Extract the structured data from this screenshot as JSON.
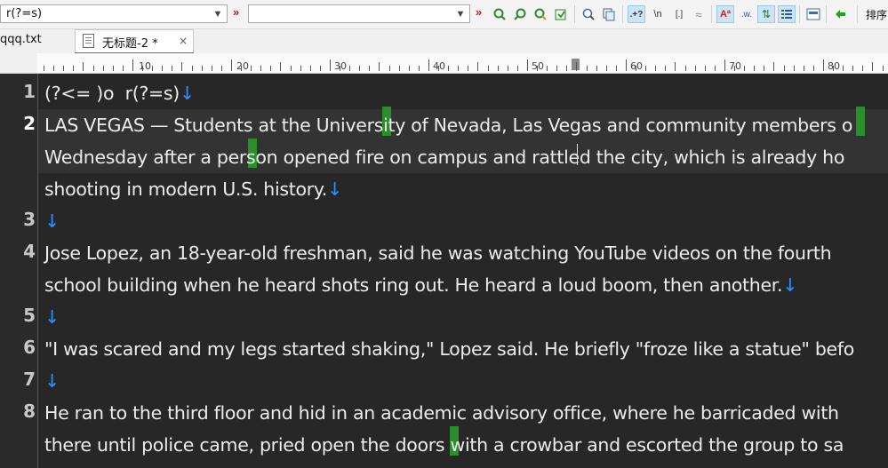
{
  "toolbar": {
    "find_combo_value": "r(?=s)",
    "replace_combo_value": "",
    "arrow_glyph": "»",
    "right_text": "排序",
    "icons": [
      "find-next-icon",
      "find-prev-icon",
      "find-all-icon",
      "replace-icon",
      "search-icon",
      "copy-icon",
      "regex-icon",
      "newline-icon",
      "wildcard-icon",
      "fuzzy-icon",
      "case-icon",
      "word-icon",
      "wrap-icon",
      "list-icon",
      "panel-icon",
      "back-icon"
    ]
  },
  "tabs": [
    {
      "label": "qqq.txt",
      "active": false
    },
    {
      "label": "无标题-2 *",
      "active": true,
      "close": "×"
    }
  ],
  "ruler": {
    "labels": [
      "10",
      "20",
      "30",
      "40",
      "50",
      "60",
      "70",
      "80"
    ]
  },
  "editor": {
    "line_numbers": [
      "1",
      "2",
      "3",
      "4",
      "5",
      "6",
      "7",
      "8"
    ],
    "rows": [
      "(?<= )o  r(?=s)",
      "LAS VEGAS — Students at the University of Nevada, Las Vegas and community members o",
      "Wednesday after a person opened fire on campus and rattled the city, which is already ho",
      "shooting in modern U.S. history.",
      "",
      "Jose Lopez, an 18-year-old freshman, said he was watching YouTube videos on the fourth ",
      "school building when he heard shots ring out. He heard a loud boom, then another.",
      "",
      "\"I was scared and my legs started shaking,\" Lopez said. He briefly \"froze like a statue\" befo",
      "",
      "He ran to the third floor and hid in an academic advisory office, where he barricaded with",
      "there until police came, pried open the doors with a crowbar and escorted the group to sa"
    ],
    "eol_marker": "↓",
    "highlight_color": "#2a8f2a",
    "eol_color": "#2f8fff"
  }
}
